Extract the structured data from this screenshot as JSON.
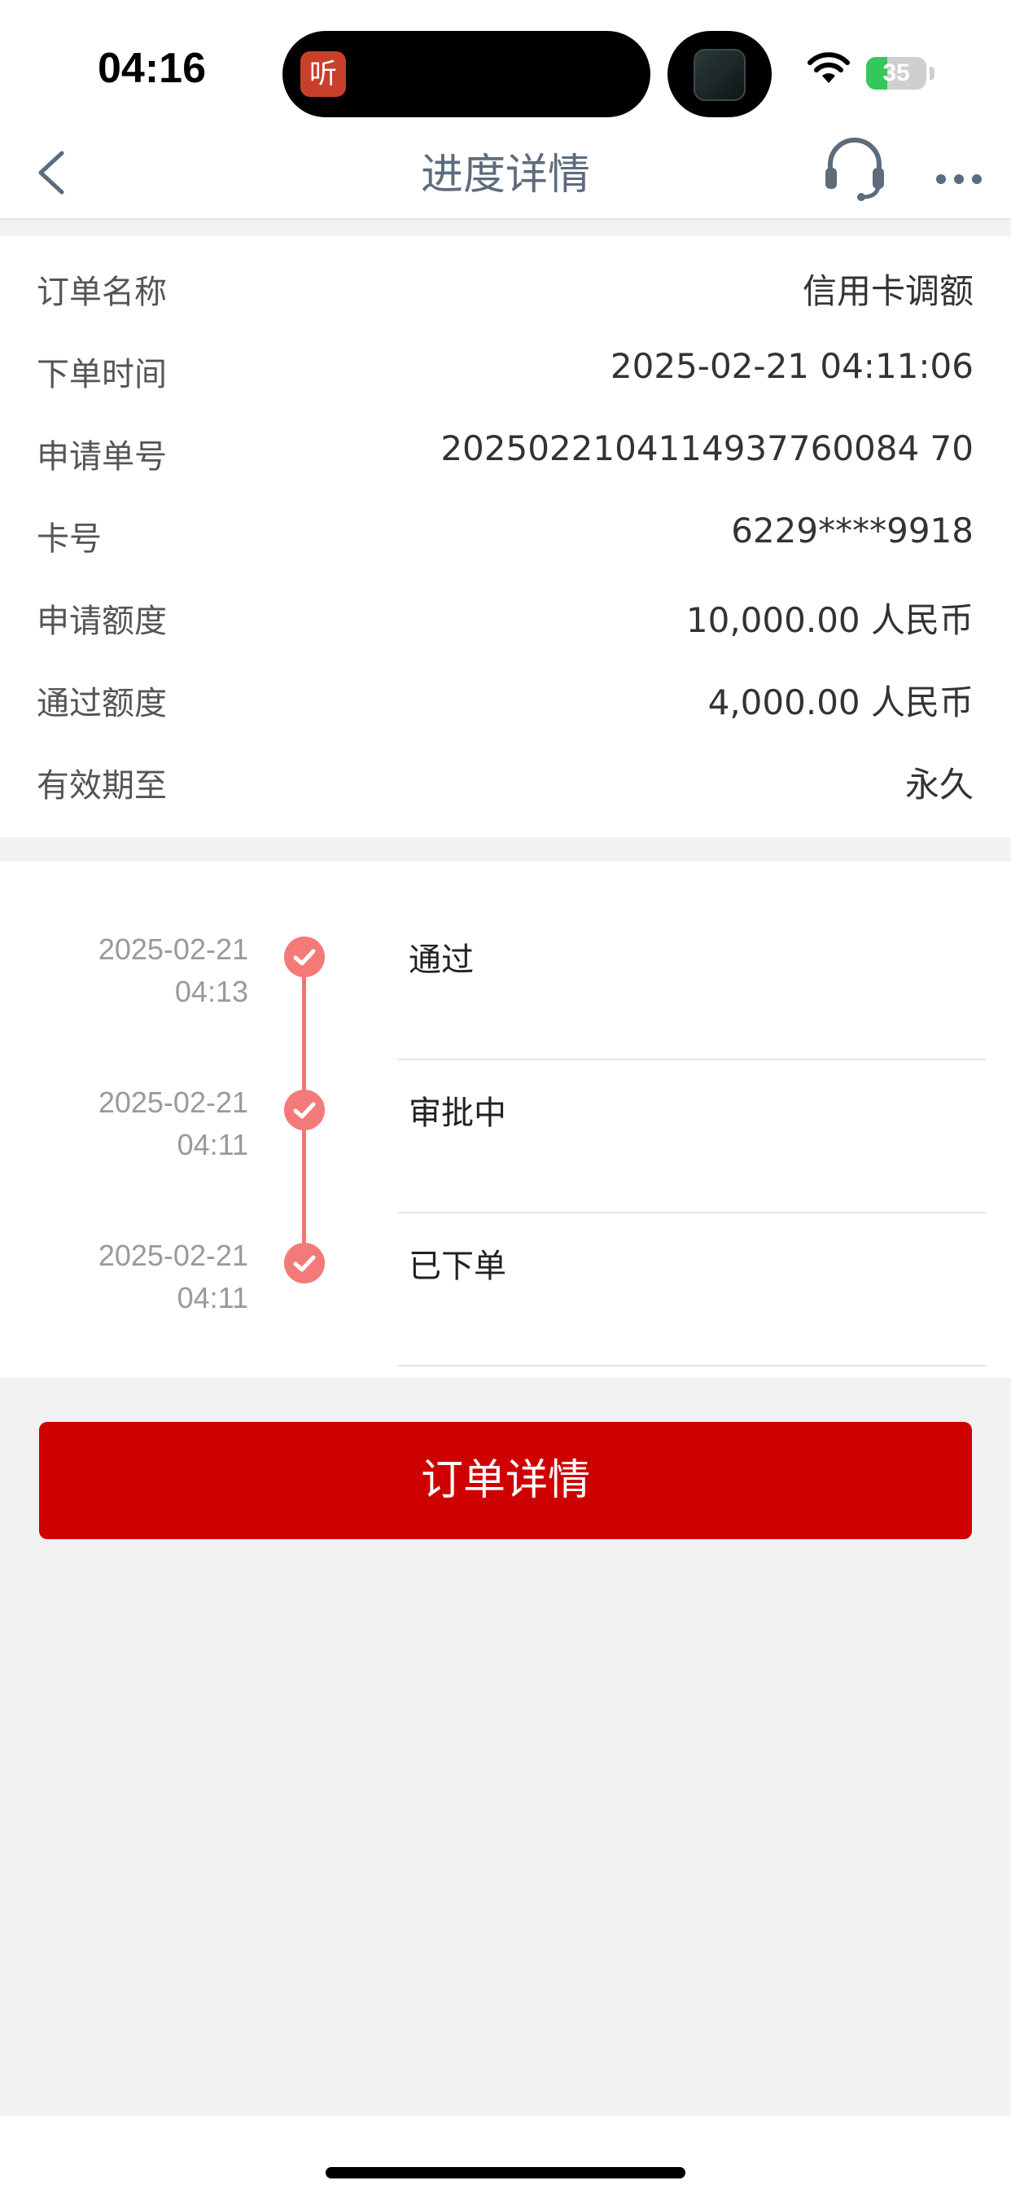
{
  "status_bar": {
    "time": "04:16",
    "island_app_glyph": "听",
    "battery_level": "35",
    "battery_percent": 35,
    "icons": [
      "wifi-icon",
      "battery-icon"
    ]
  },
  "nav": {
    "title": "进度详情",
    "icons": [
      "chevron-left-icon",
      "headset-icon",
      "more-icon"
    ]
  },
  "info": [
    {
      "label": "订单名称",
      "value": "信用卡调额"
    },
    {
      "label": "下单时间",
      "value": "2025-02-21 04:11:06"
    },
    {
      "label": "申请单号",
      "value": "2025022104114937760084 70"
    },
    {
      "label": "卡号",
      "value": "6229****9918"
    },
    {
      "label": "申请额度",
      "value": "10,000.00 人民币"
    },
    {
      "label": "通过额度",
      "value": "4,000.00 人民币"
    },
    {
      "label": "有效期至",
      "value": "永久"
    }
  ],
  "timeline": [
    {
      "date": "2025-02-21",
      "time": "04:13",
      "status": "通过"
    },
    {
      "date": "2025-02-21",
      "time": "04:11",
      "status": "审批中"
    },
    {
      "date": "2025-02-21",
      "time": "04:11",
      "status": "已下单"
    }
  ],
  "button": {
    "label": "订单详情"
  },
  "colors": {
    "accent_red": "#cf0000",
    "timeline_pink": "#f47a7a",
    "nav_title": "#5d6c7d",
    "background": "#f2f2f2"
  }
}
